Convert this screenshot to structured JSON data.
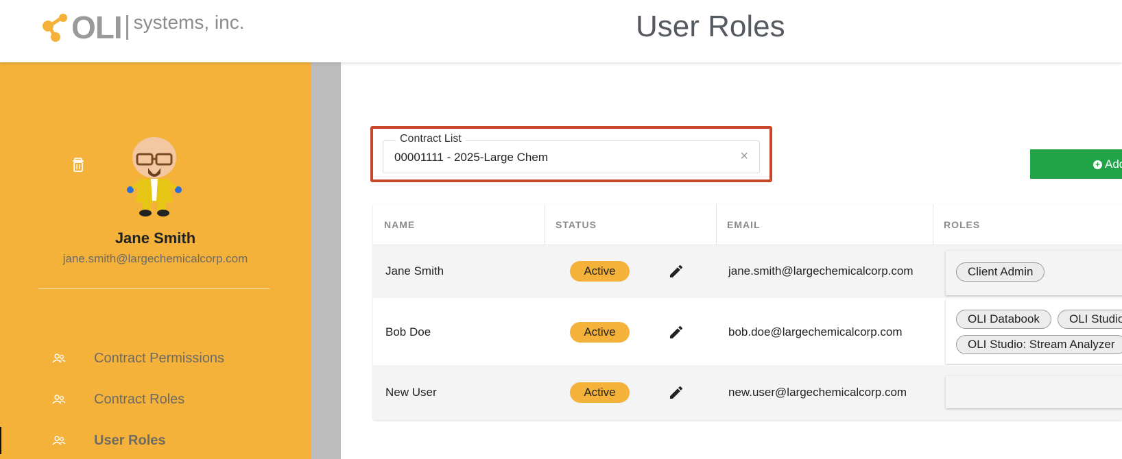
{
  "header": {
    "logo_text": "OLI",
    "logo_subtext": "systems, inc.",
    "page_title": "User Roles"
  },
  "sidebar": {
    "user_name": "Jane Smith",
    "user_email": "jane.smith@largechemicalcorp.com",
    "nav": [
      {
        "label": "Contract Permissions",
        "icon": "users-icon",
        "active": false
      },
      {
        "label": "Contract Roles",
        "icon": "users-icon",
        "active": false
      },
      {
        "label": "User Roles",
        "icon": "users-icon",
        "active": true
      }
    ]
  },
  "contract_list": {
    "legend": "Contract List",
    "value": "00001111 - 2025-Large Chem",
    "clear_glyph": "×"
  },
  "add_button": {
    "label": "Add"
  },
  "table": {
    "headers": [
      "NAME",
      "STATUS",
      "EMAIL",
      "ROLES"
    ],
    "rows": [
      {
        "name": "Jane Smith",
        "status": "Active",
        "email": "jane.smith@largechemicalcorp.com",
        "roles": [
          "Client Admin"
        ]
      },
      {
        "name": "Bob Doe",
        "status": "Active",
        "email": "bob.doe@largechemicalcorp.com",
        "roles": [
          "OLI Databook",
          "OLI Studio",
          "OLI Studio: Stream Analyzer"
        ]
      },
      {
        "name": "New User",
        "status": "Active",
        "email": "new.user@largechemicalcorp.com",
        "roles": []
      }
    ]
  },
  "colors": {
    "sidebar": "#f4b23a",
    "accent_red": "#c6462a",
    "add_green": "#21a448",
    "badge": "#f4b23a"
  }
}
